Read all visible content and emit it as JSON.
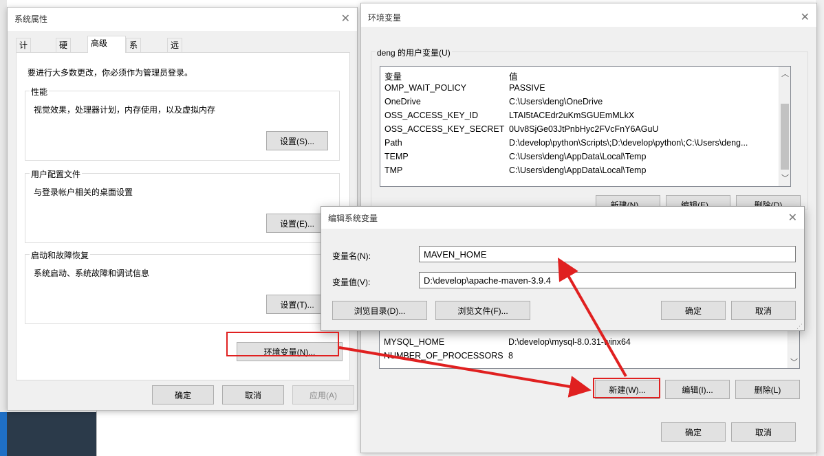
{
  "system_properties": {
    "title": "系统属性",
    "tabs": [
      "计算机名",
      "硬件",
      "高级",
      "系统保护",
      "远程"
    ],
    "active_tab": "高级",
    "admin_note": "要进行大多数更改，你必须作为管理员登录。",
    "performance": {
      "label": "性能",
      "desc": "视觉效果，处理器计划，内存使用，以及虚拟内存",
      "button": "设置(S)..."
    },
    "user_profiles": {
      "label": "用户配置文件",
      "desc": "与登录帐户相关的桌面设置",
      "button": "设置(E)..."
    },
    "startup_recovery": {
      "label": "启动和故障恢复",
      "desc": "系统启动、系统故障和调试信息",
      "button": "设置(T)..."
    },
    "env_button": "环境变量(N)...",
    "ok": "确定",
    "cancel": "取消",
    "apply": "应用(A)"
  },
  "env_vars": {
    "title": "环境变量",
    "user_group_label": "deng 的用户变量(U)",
    "columns": [
      "变量",
      "值"
    ],
    "user_rows": [
      [
        "OMP_WAIT_POLICY",
        "PASSIVE"
      ],
      [
        "OneDrive",
        "C:\\Users\\deng\\OneDrive"
      ],
      [
        "OSS_ACCESS_KEY_ID",
        "LTAI5tACEdr2uKmSGUEmMLkX"
      ],
      [
        "OSS_ACCESS_KEY_SECRET",
        "0Uv8SjGe03JtPnbHyc2FVcFnY6AGuU"
      ],
      [
        "Path",
        "D:\\develop\\python\\Scripts\\;D:\\develop\\python\\;C:\\Users\\deng..."
      ],
      [
        "TEMP",
        "C:\\Users\\deng\\AppData\\Local\\Temp"
      ],
      [
        "TMP",
        "C:\\Users\\deng\\AppData\\Local\\Temp"
      ]
    ],
    "user_buttons": {
      "new": "新建(N)...",
      "edit": "编辑(E)...",
      "delete": "删除(D)"
    },
    "system_rows": [
      [
        "MYSQL_HOME",
        "D:\\develop\\mysql-8.0.31-winx64"
      ],
      [
        "NUMBER_OF_PROCESSORS",
        "8"
      ]
    ],
    "system_buttons": {
      "new": "新建(W)...",
      "edit": "编辑(I)...",
      "delete": "删除(L)"
    },
    "ok": "确定",
    "cancel": "取消"
  },
  "edit_dialog": {
    "title": "编辑系统变量",
    "name_label": "变量名(N):",
    "name_value": "MAVEN_HOME",
    "value_label": "变量值(V):",
    "value_value": "D:\\develop\\apache-maven-3.9.4",
    "browse_dir": "浏览目录(D)...",
    "browse_file": "浏览文件(F)...",
    "ok": "确定",
    "cancel": "取消"
  },
  "icons": {
    "close": "close-icon",
    "scroll_up": "chevron-up-icon",
    "scroll_down": "chevron-down-icon"
  },
  "colors": {
    "annotation_red": "#e02020",
    "dialog_bg": "#f0f0f0"
  }
}
